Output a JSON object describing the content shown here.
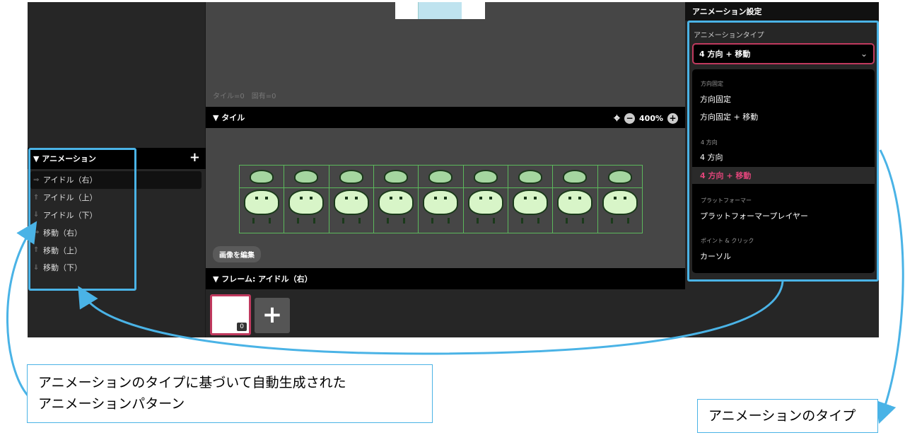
{
  "left": {
    "animation_header": "▼ アニメーション",
    "add_label": "+",
    "animations": [
      {
        "icon": "arrow-right-icon",
        "glyph": "⇒",
        "label": "アイドル（右）",
        "selected": true
      },
      {
        "icon": "arrow-up-icon",
        "glyph": "⇑",
        "label": "アイドル（上）",
        "selected": false
      },
      {
        "icon": "arrow-down-icon",
        "glyph": "⇓",
        "label": "アイドル（下）",
        "selected": false
      },
      {
        "icon": "arrow-right-icon",
        "glyph": "⇒",
        "label": "移動（右）",
        "selected": false
      },
      {
        "icon": "arrow-up-icon",
        "glyph": "⇑",
        "label": "移動（上）",
        "selected": false
      },
      {
        "icon": "arrow-down-icon",
        "glyph": "⇓",
        "label": "移動（下）",
        "selected": false
      }
    ]
  },
  "center": {
    "tile_count": "タイル=0　固有=0",
    "tile_header": "▼ タイル",
    "zoom_level": "400%",
    "zoom_minus": "−",
    "zoom_plus": "+",
    "target_glyph": "⌖",
    "sprite_frames": 9,
    "edit_image_label": "画像を編集",
    "frame_header": "▼ フレーム: アイドル（右）",
    "frame_index": "0",
    "frame_add_label": "+"
  },
  "right": {
    "settings_header": "アニメーション設定",
    "type_label": "アニメーションタイプ",
    "type_selected": "4 方向 + 移動",
    "chevron": "⌄",
    "dropdown": {
      "group_fixed": "方向固定",
      "opt_fixed": "方向固定",
      "opt_fixed_move": "方向固定 + 移動",
      "group_4dir": "4 方向",
      "opt_4dir": "4 方向",
      "opt_4dir_move": "4 方向 + 移動",
      "group_platformer": "プラットフォーマー",
      "opt_platformer": "プラットフォーマープレイヤー",
      "group_point": "ポイント & クリック",
      "opt_cursor": "カーソル"
    }
  },
  "annotations": {
    "callout_left_line1": "アニメーションのタイプに基づいて自動生成された",
    "callout_left_line2": "アニメーションパターン",
    "callout_right": "アニメーションのタイプ"
  },
  "colors": {
    "highlight": "#4ab3e6",
    "accent": "#c0395e",
    "active_option": "#e0457a",
    "grid": "#5cb85c"
  }
}
